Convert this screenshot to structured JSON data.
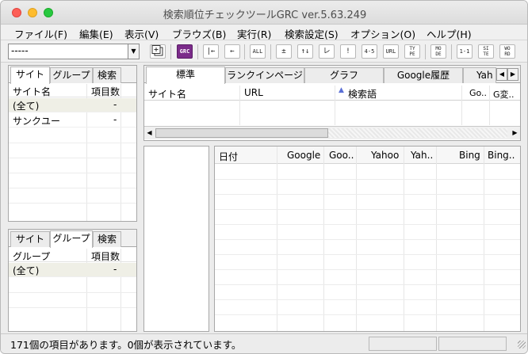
{
  "window": {
    "title": "検索順位チェックツールGRC  ver.5.63.249"
  },
  "menu": [
    {
      "label": "ファイル(F)"
    },
    {
      "label": "編集(E)"
    },
    {
      "label": "表示(V)"
    },
    {
      "label": "ブラウズ(B)"
    },
    {
      "label": "実行(R)"
    },
    {
      "label": "検索設定(S)"
    },
    {
      "label": "オプション(O)"
    },
    {
      "label": "ヘルプ(H)"
    }
  ],
  "toolbar": {
    "combo_value": "-----",
    "buttons": [
      {
        "label": "GRC",
        "icon": "grc-logo-icon"
      },
      {
        "label": "|←",
        "icon": "first-icon"
      },
      {
        "label": "←",
        "icon": "back-icon"
      },
      {
        "label": "ALL"
      },
      {
        "label": "±"
      },
      {
        "label": "↑↓"
      },
      {
        "label": "レ"
      },
      {
        "label": "!"
      },
      {
        "label": "4-5"
      },
      {
        "label": "URL"
      },
      {
        "label": "TY PE"
      },
      {
        "label": "MO DE"
      },
      {
        "label": "1-1"
      },
      {
        "label": "SI TE"
      },
      {
        "label": "WO RD"
      }
    ]
  },
  "site_pane": {
    "tabs": [
      "サイト",
      "グループ",
      "検索"
    ],
    "columns": [
      "サイト名",
      "項目数"
    ],
    "rows": [
      {
        "name": "(全て)",
        "count": "-"
      },
      {
        "name": "サンクユー",
        "count": "-"
      }
    ]
  },
  "group_pane": {
    "tabs": [
      "サイト",
      "グループ",
      "検索"
    ],
    "columns": [
      "グループ",
      "項目数"
    ],
    "rows": [
      {
        "name": "(全て)",
        "count": "-"
      }
    ]
  },
  "rank_pane": {
    "tabs": [
      "標準",
      "ランクインページ",
      "グラフ",
      "Google履歴",
      "Yah"
    ],
    "columns": [
      "サイト名",
      "URL",
      "検索語",
      "Go..",
      "G変.."
    ]
  },
  "history_pane": {
    "columns": [
      "日付",
      "Google",
      "Goo..",
      "Yahoo",
      "Yah..",
      "Bing",
      "Bing.."
    ]
  },
  "status": {
    "text": "171個の項目があります。0個が表示されています。"
  }
}
